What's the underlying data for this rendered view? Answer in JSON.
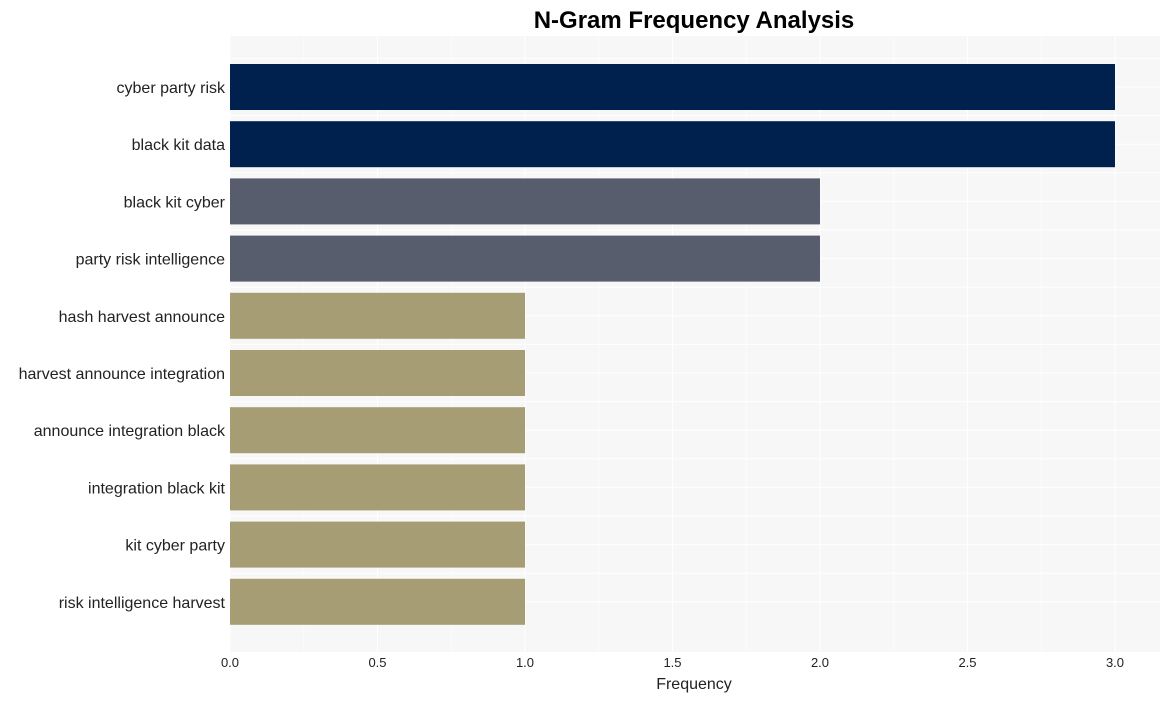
{
  "chart_data": {
    "type": "bar",
    "orientation": "horizontal",
    "title": "N-Gram Frequency Analysis",
    "xlabel": "Frequency",
    "ylabel": "",
    "xlim": [
      0,
      3.15
    ],
    "xticks": [
      0.0,
      0.5,
      1.0,
      1.5,
      2.0,
      2.5,
      3.0
    ],
    "xtick_labels": [
      "0.0",
      "0.5",
      "1.0",
      "1.5",
      "2.0",
      "2.5",
      "3.0"
    ],
    "grid": true,
    "legend": "none",
    "categories": [
      "cyber party risk",
      "black kit data",
      "black kit cyber",
      "party risk intelligence",
      "hash harvest announce",
      "harvest announce integration",
      "announce integration black",
      "integration black kit",
      "kit cyber party",
      "risk intelligence harvest"
    ],
    "values": [
      3,
      3,
      2,
      2,
      1,
      1,
      1,
      1,
      1,
      1
    ],
    "colors": {
      "3": "#00204e",
      "2": "#575d6d",
      "1": "#a69d75",
      "plot_background": "#f7f7f7",
      "grid": "#ffffff"
    }
  }
}
